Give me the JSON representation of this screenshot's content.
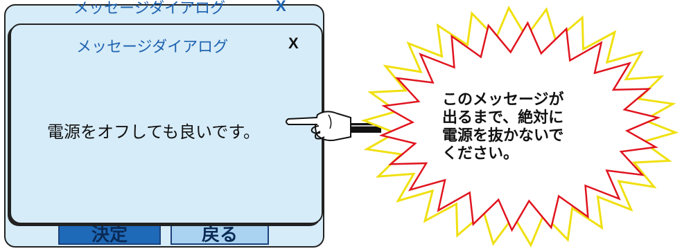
{
  "back_dialog": {
    "title": "メッセージダイアログ",
    "close_label": "X",
    "ok_label": "決定",
    "back_label": "戻る"
  },
  "front_dialog": {
    "title": "メッセージダイアログ",
    "close_label": "X",
    "message": "電源をオフしても良いです。"
  },
  "callout": {
    "lines": [
      "このメッセージが",
      "出るまで、絶対に",
      "電源を抜かないで",
      "ください。"
    ]
  },
  "colors": {
    "dialog_bg": "#d6ecf8",
    "title_blue": "#1f63b0",
    "burst_red": "#e0141e",
    "burst_yellow": "#f0e010"
  },
  "icons": [
    "pointing-hand-icon",
    "explosion-burst-icon"
  ]
}
